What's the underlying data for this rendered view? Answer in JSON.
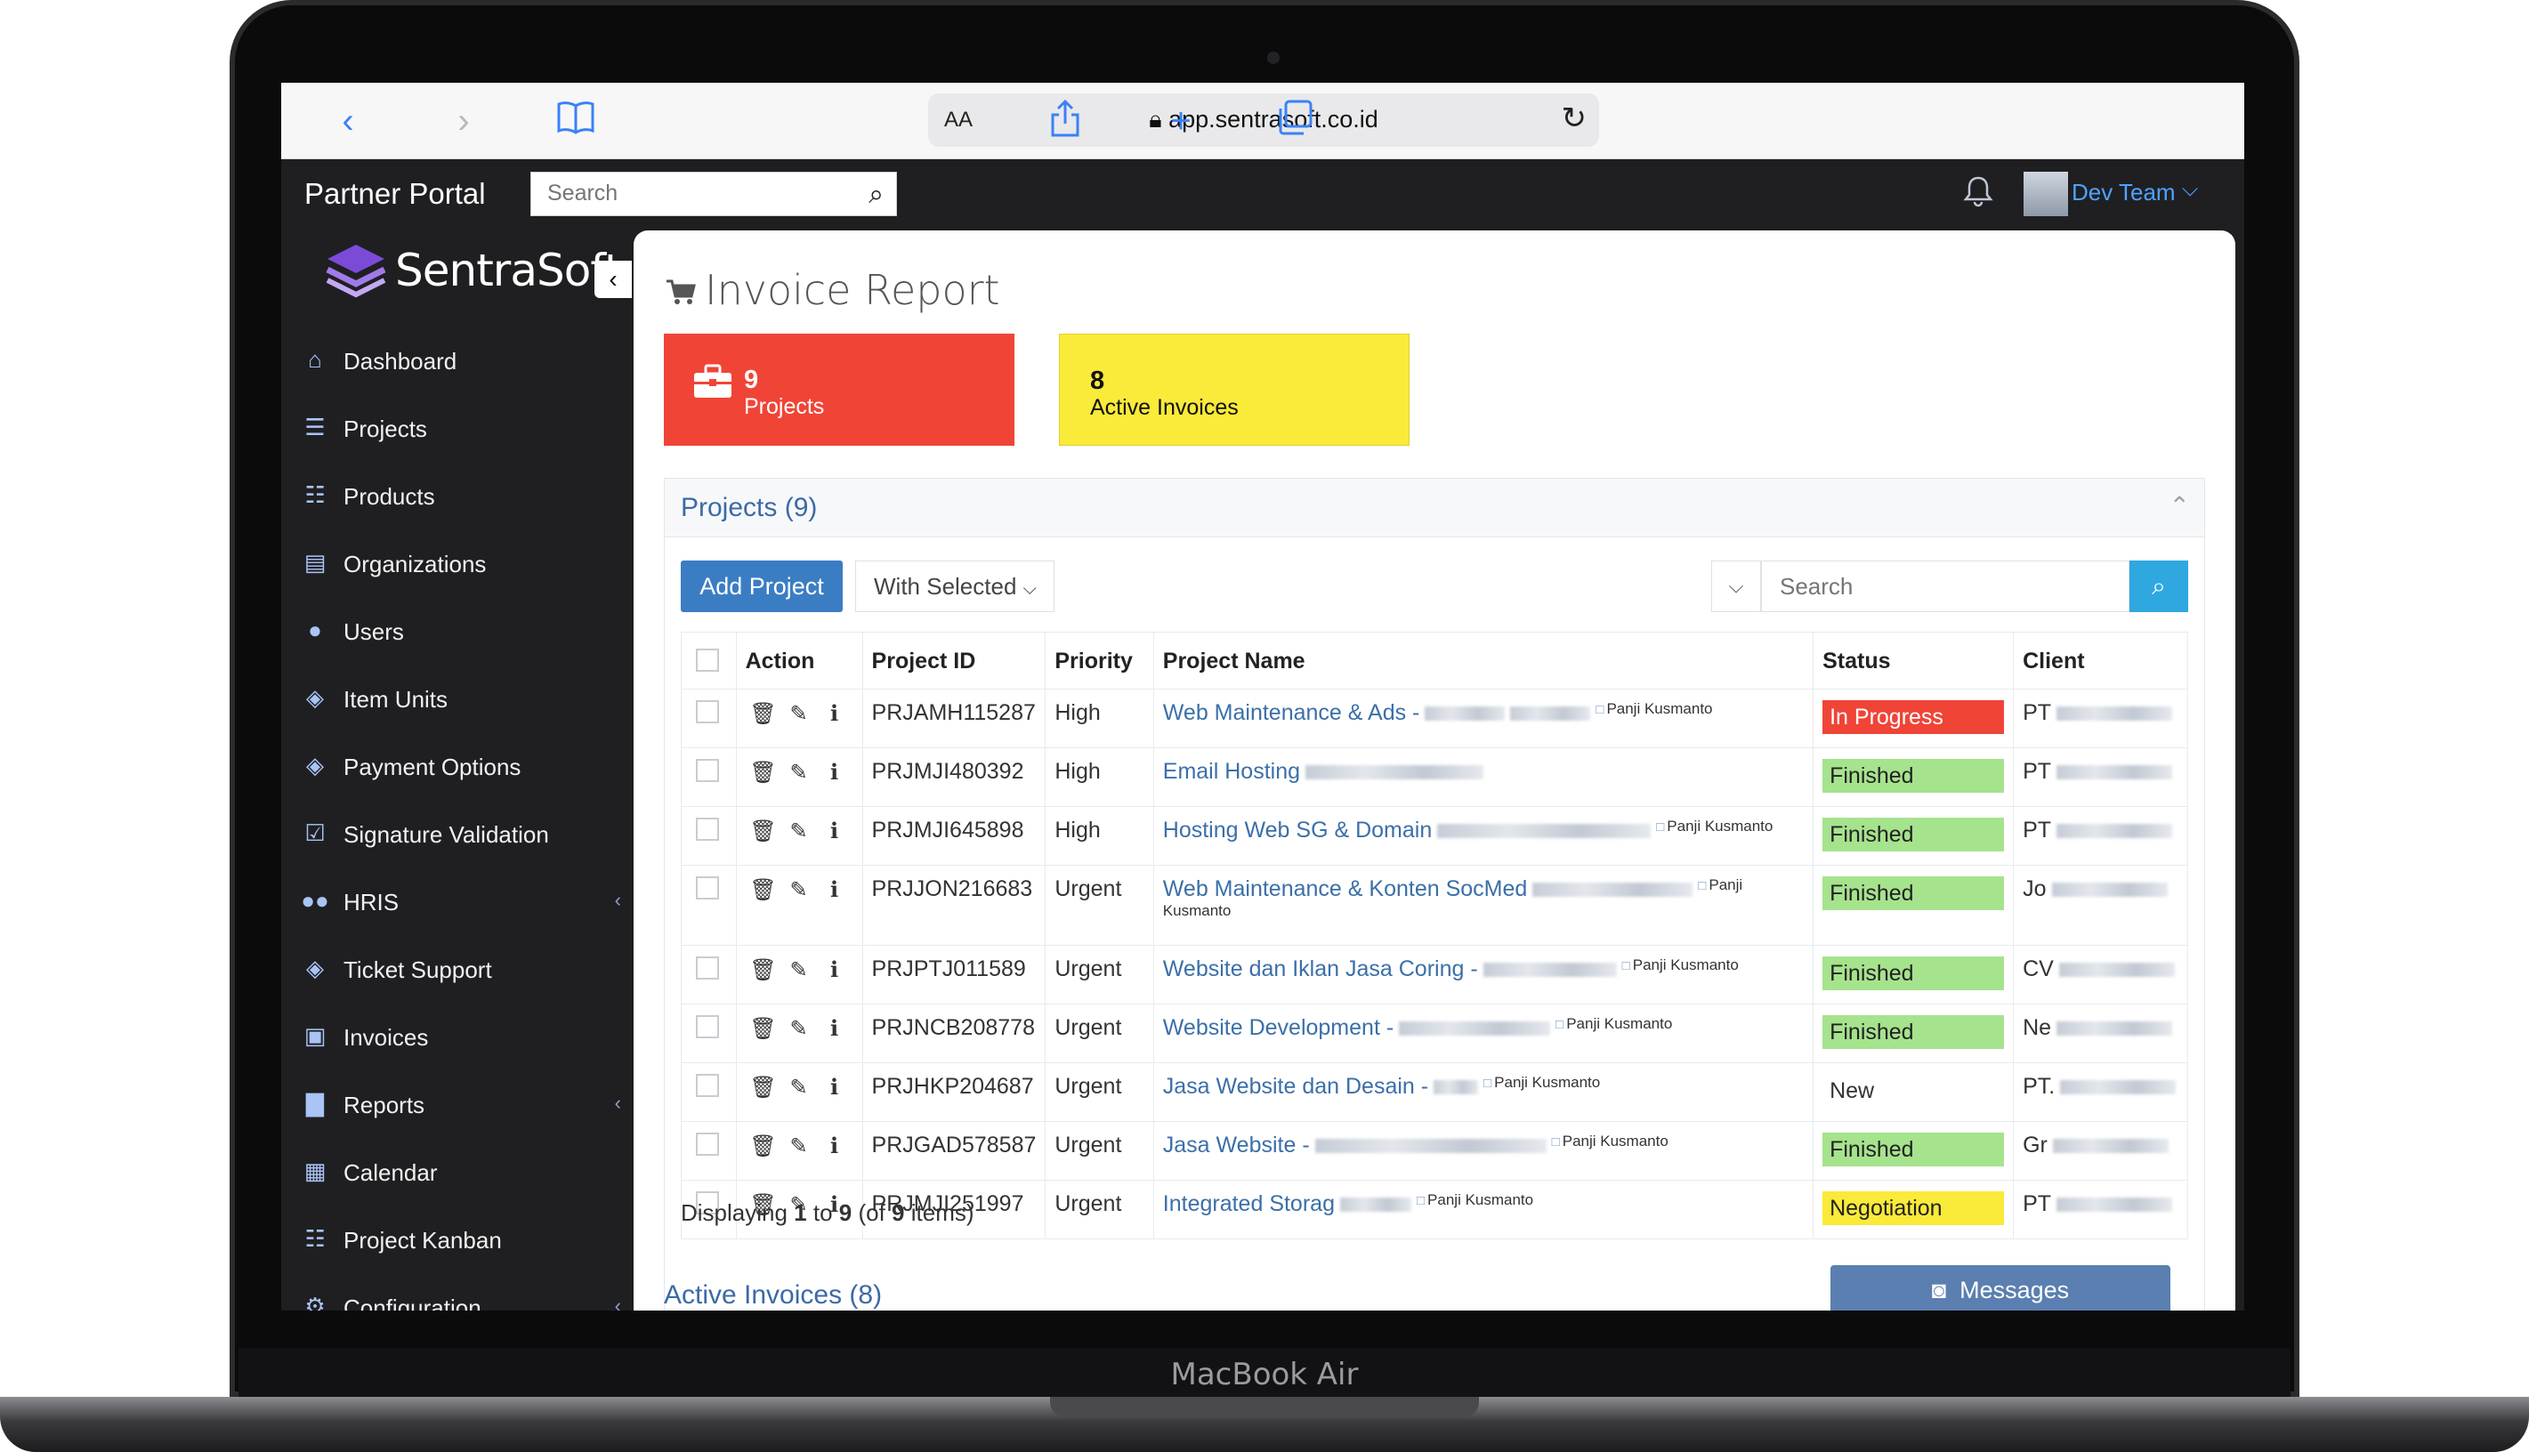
{
  "device": {
    "label": "MacBook Air"
  },
  "browser": {
    "reader_label": "AA",
    "url": "app.sentrasoft.co.id"
  },
  "topbar": {
    "title": "Partner Portal",
    "search_placeholder": "Search",
    "user_name": "Dev Team"
  },
  "brand": {
    "name": "SentraSoft"
  },
  "sidebar": {
    "items": [
      {
        "label": "Dashboard",
        "icon": "home-icon"
      },
      {
        "label": "Projects",
        "icon": "list-icon"
      },
      {
        "label": "Products",
        "icon": "grid-icon"
      },
      {
        "label": "Organizations",
        "icon": "building-icon"
      },
      {
        "label": "Users",
        "icon": "user-icon"
      },
      {
        "label": "Item Units",
        "icon": "tag-icon"
      },
      {
        "label": "Payment Options",
        "icon": "tag-icon"
      },
      {
        "label": "Signature Validation",
        "icon": "check-square-icon"
      },
      {
        "label": "HRIS",
        "icon": "users-icon"
      },
      {
        "label": "Ticket Support",
        "icon": "tag-icon"
      },
      {
        "label": "Invoices",
        "icon": "money-icon"
      },
      {
        "label": "Reports",
        "icon": "bar-chart-icon"
      },
      {
        "label": "Calendar",
        "icon": "calendar-icon"
      },
      {
        "label": "Project Kanban",
        "icon": "grid-icon"
      },
      {
        "label": "Configuration",
        "icon": "gear-icon"
      }
    ]
  },
  "page": {
    "title": "Invoice Report",
    "cards": [
      {
        "count": "9",
        "label": "Projects",
        "color": "#f04437"
      },
      {
        "count": "8",
        "label": "Active Invoices",
        "color": "#faea3a"
      }
    ]
  },
  "projects": {
    "title": "Projects (9)",
    "add_label": "Add Project",
    "with_selected_label": "With Selected",
    "search_placeholder": "Search",
    "columns": [
      "Action",
      "Project ID",
      "Priority",
      "Project Name",
      "Status",
      "Client"
    ],
    "rows": [
      {
        "id": "PRJAMH115287",
        "priority": "High",
        "name": "Web Maintenance & Ads -",
        "assignee": "Panji Kusmanto",
        "status": "In Progress",
        "status_class": "b-progress",
        "client": "PT"
      },
      {
        "id": "PRJMJI480392",
        "priority": "High",
        "name": "Email Hosting",
        "assignee": "",
        "status": "Finished",
        "status_class": "b-finished",
        "client": "PT"
      },
      {
        "id": "PRJMJI645898",
        "priority": "High",
        "name": "Hosting Web SG & Domain",
        "assignee": "Panji Kusmanto",
        "status": "Finished",
        "status_class": "b-finished",
        "client": "PT"
      },
      {
        "id": "PRJJON216683",
        "priority": "Urgent",
        "name": "Web Maintenance & Konten SocMed",
        "assignee": "Panji Kusmanto",
        "status": "Finished",
        "status_class": "b-finished",
        "client": "Jo"
      },
      {
        "id": "PRJPTJ011589",
        "priority": "Urgent",
        "name": "Website dan Iklan Jasa Coring -",
        "assignee": "Panji Kusmanto",
        "status": "Finished",
        "status_class": "b-finished",
        "client": "CV"
      },
      {
        "id": "PRJNCB208778",
        "priority": "Urgent",
        "name": "Website Development -",
        "assignee": "Panji Kusmanto",
        "status": "Finished",
        "status_class": "b-finished",
        "client": "Ne"
      },
      {
        "id": "PRJHKP204687",
        "priority": "Urgent",
        "name": "Jasa Website dan Desain -",
        "assignee": "Panji Kusmanto",
        "status": "New",
        "status_class": "b-new",
        "client": "PT."
      },
      {
        "id": "PRJGAD578587",
        "priority": "Urgent",
        "name": "Jasa Website -",
        "assignee": "Panji Kusmanto",
        "status": "Finished",
        "status_class": "b-finished",
        "client": "Gr"
      },
      {
        "id": "PRJMJI251997",
        "priority": "Urgent",
        "name": "Integrated Storag",
        "assignee": "Panji Kusmanto",
        "status": "Negotiation",
        "status_class": "b-nego",
        "client": "PT"
      }
    ],
    "footer": {
      "prefix": "Displaying ",
      "from": "1",
      "to_word": " to ",
      "to": "9",
      "of_prefix": " (of ",
      "total": "9",
      "of_suffix": " items)"
    }
  },
  "messages_label": "Messages",
  "next_section_title": "Active Invoices (8)"
}
